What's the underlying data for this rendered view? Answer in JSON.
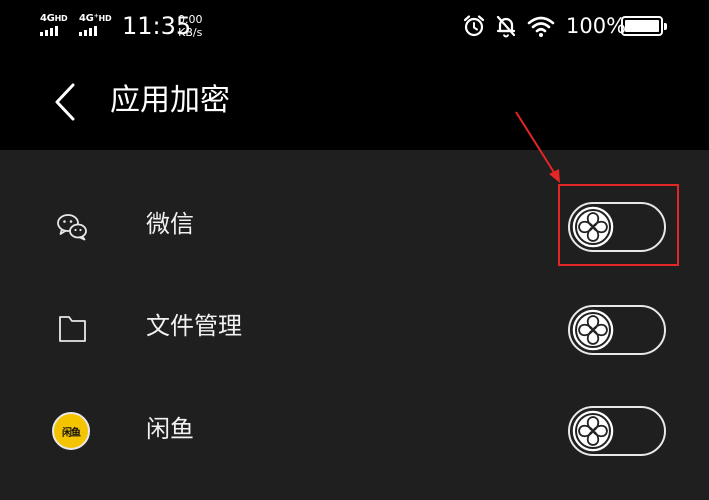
{
  "status_bar": {
    "signal1": "4G",
    "signal1_sup": "HD",
    "signal2": "4G⁺",
    "signal2_sup": "HD",
    "time": "11:35",
    "speed_value": "0.00",
    "speed_unit": "KB/s",
    "battery": "100%",
    "icons": [
      "alarm-icon",
      "mute-bell-icon",
      "wifi-icon",
      "battery-icon"
    ]
  },
  "header": {
    "title": "应用加密",
    "back_icon": "back-chevron-icon"
  },
  "apps": [
    {
      "label": "微信",
      "icon": "wechat-icon",
      "enabled": false
    },
    {
      "label": "文件管理",
      "icon": "folder-icon",
      "enabled": false
    },
    {
      "label": "闲鱼",
      "icon": "xianyu-icon",
      "icon_text": "闲鱼",
      "enabled": false
    }
  ],
  "colors": {
    "header_bg": "#000000",
    "list_bg": "#1f1f1f",
    "annotation": "#e32626",
    "xianyu_badge": "#f5c400"
  }
}
